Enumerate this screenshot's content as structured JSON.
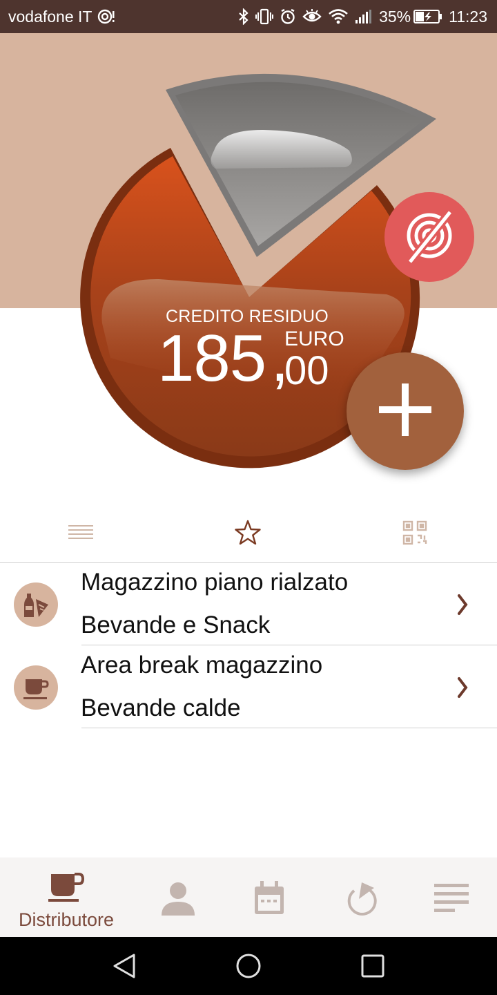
{
  "status_bar": {
    "carrier": "vodafone IT",
    "battery": "35%",
    "time": "11:23",
    "icons": [
      "nfc-icon",
      "bluetooth-icon",
      "vibrate-icon",
      "alarm-icon",
      "eye-icon",
      "wifi-icon",
      "signal-icon",
      "battery-charging-icon"
    ]
  },
  "credit": {
    "label": "CREDITO RESIDUO",
    "integer": "185",
    "comma": ",",
    "decimal": "00",
    "currency": "EURO"
  },
  "colors": {
    "status_bar": "#4e342e",
    "hero_bg": "#d7b49e",
    "credit_orange": "#c0501e",
    "nfc_button": "#e15a5a",
    "add_button": "#a2613d",
    "accent_brown": "#7b4a3c"
  },
  "tabs": [
    {
      "name": "list-view",
      "icon": "list-icon"
    },
    {
      "name": "favorites",
      "icon": "star-icon",
      "active": true
    },
    {
      "name": "qr-scan",
      "icon": "qr-code-icon"
    }
  ],
  "list": [
    {
      "title": "Magazzino piano rialzato",
      "subtitle": "Bevande e Snack",
      "icon": "drink-snack-icon"
    },
    {
      "title": "Area break magazzino",
      "subtitle": "Bevande calde",
      "icon": "coffee-cup-icon"
    }
  ],
  "bottom_nav": [
    {
      "label": "Distributore",
      "icon": "coffee-cup-icon",
      "active": true
    },
    {
      "label": "",
      "icon": "user-icon"
    },
    {
      "label": "",
      "icon": "calendar-icon"
    },
    {
      "label": "",
      "icon": "history-icon"
    },
    {
      "label": "",
      "icon": "menu-icon"
    }
  ],
  "system_nav": [
    "back-icon",
    "home-icon",
    "recents-icon"
  ]
}
